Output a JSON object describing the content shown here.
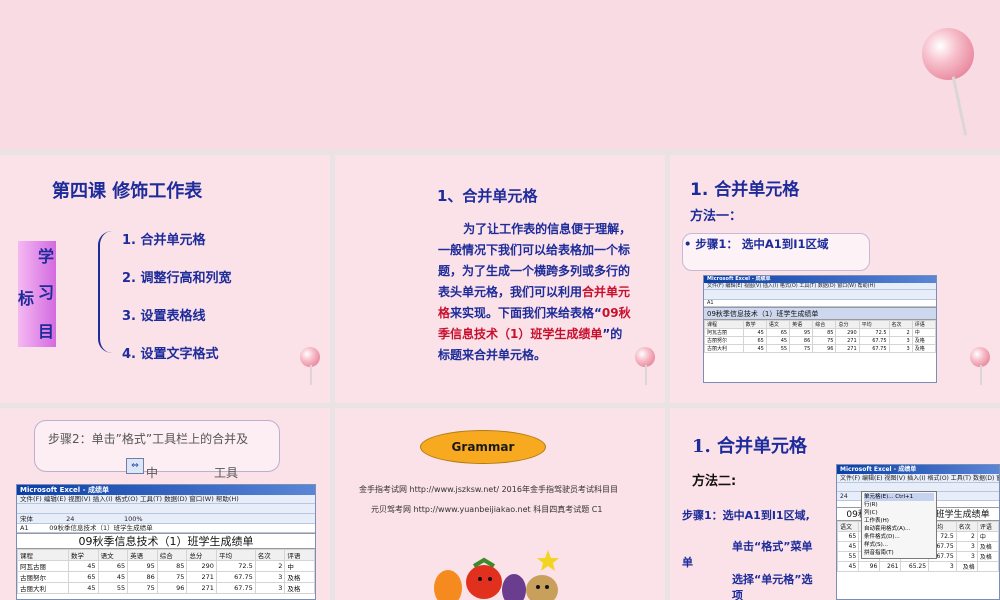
{
  "slide1": {
    "title": "第四课   修饰工作表",
    "objective_chars": [
      "学",
      "标",
      "习",
      "目"
    ],
    "items": [
      "1. 合并单元格",
      "2. 调整行高和列宽",
      "3. 设置表格线",
      "4. 设置文字格式"
    ]
  },
  "slide2": {
    "heading": "1、合并单元格",
    "body_before": "为了让工作表的信息便于理解，一般情况下我们可以给表格加一个标题，为了生成一个横跨多列或多行的表头单元格，我们可以利用",
    "body_red1": "合并单元格",
    "body_mid": "来实现。下面我们来给表格“",
    "body_red2": "09秋季信息技术（1）班学生成绩单",
    "body_after": "”的标题来合并单元格。"
  },
  "slide3": {
    "heading": "1. 合并单元格",
    "method": "方法一：",
    "bullet": "步骤1：   选中A1到I1区域"
  },
  "slide4": {
    "step_line1": "步骤2：单击”格式”工具栏上的合并及",
    "step_mid": "中",
    "step_tail": "工具",
    "merge_icon_name": "merge-center-icon"
  },
  "slide5": {
    "grammar": "Grammar",
    "line1": "金手指考试网  http://www.jszksw.net/ 2016年金手指驾驶员考试科目目",
    "line2": "元贝驾考网  http://www.yuanbeijiakao.net 科目四真考试题          C1"
  },
  "slide6": {
    "heading": "1. 合并单元格",
    "method": "方法二:",
    "step1": "步骤1：选中A1到I1区域,",
    "step2": "单击“格式”菜单",
    "step3": "选择“单元格”选项",
    "menu_items": [
      "单元格(E)...   Ctrl+1",
      "行(R)",
      "列(C)",
      "工作表(H)",
      "自动套用格式(A)...",
      "条件格式(D)...",
      "样式(S)...",
      "拼音指南(T)"
    ]
  },
  "excel": {
    "window_title": "Microsoft Excel - 成绩单",
    "menu": "文件(F)  编辑(E)  视图(V)  插入(I)  格式(O)  工具(T)  数据(D)  窗口(W)  帮助(H)",
    "font_name": "宋体",
    "font_size": "24",
    "zoom": "100%",
    "cell_ref": "A1",
    "formula": "09秋季信息技术（1）班学生成绩单",
    "sheet_title": "09秋季信息技术（1）班学生成绩单",
    "headers": [
      "课程",
      "数学",
      "语文",
      "英语",
      "综合",
      "总分",
      "平均",
      "名次",
      "评语"
    ],
    "rows": [
      [
        "阿瓦古丽",
        "45",
        "65",
        "95",
        "85",
        "290",
        "72.5",
        "2",
        "中"
      ],
      [
        "古丽努尔",
        "65",
        "45",
        "86",
        "75",
        "271",
        "67.75",
        "3",
        "及格"
      ],
      [
        "古丽大利",
        "45",
        "55",
        "75",
        "96",
        "271",
        "67.75",
        "3",
        "及格"
      ]
    ],
    "rows_s6": [
      [
        "65",
        "95",
        "85",
        "290",
        "72.5",
        "2",
        "中"
      ],
      [
        "45",
        "86",
        "75",
        "271",
        "67.75",
        "3",
        "及格"
      ],
      [
        "55",
        "75",
        "96",
        "271",
        "67.75",
        "3",
        "及格"
      ],
      [
        "45",
        "96",
        "261",
        "65.25",
        "3",
        "及格"
      ]
    ]
  }
}
